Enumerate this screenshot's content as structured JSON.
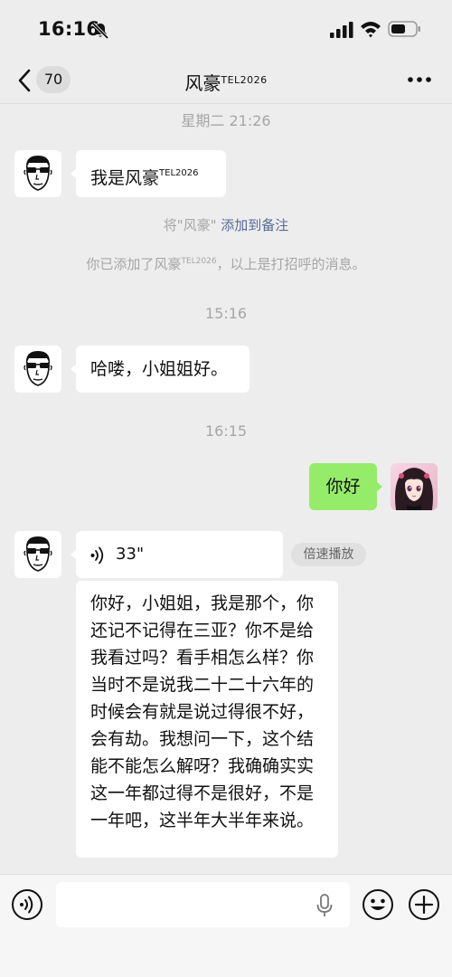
{
  "status_bar": {
    "time": "16:16"
  },
  "nav": {
    "unread_count": "70",
    "title_main": "风豪",
    "title_sup": "TEL2026"
  },
  "messages": {
    "ts1": "星期二 21:26",
    "msg1_main": "我是风豪",
    "msg1_sup": "TEL2026",
    "sys1_prefix": "将\"风豪\"",
    "sys1_link": "添加到备注",
    "sys2_prefix": "你已添加了风豪",
    "sys2_sup": "TEL2026",
    "sys2_suffix": "，以上是打招呼的消息。",
    "ts2": "15:16",
    "msg2": "哈喽，小姐姐好。",
    "ts3": "16:15",
    "msg3_self": "你好",
    "voice_duration": "33\"",
    "speed_label": "倍速播放",
    "transcript": "你好，小姐姐，我是那个，你还记不记得在三亚？你不是给我看过吗？看手相怎么样？你当时不是说我二十二十六年的时候会有就是说过得很不好，会有劫。我想问一下，这个结能不能怎么解呀？我确确实实这一年都过得不是很好，不是一年吧，这半年大半年来说。"
  },
  "colors": {
    "background": "#ededed",
    "self_bubble": "#95ec69",
    "link": "#576b95",
    "timestamp": "#a6a6a6"
  },
  "icons": [
    "bell-slash-icon",
    "signal-icon",
    "wifi-icon",
    "battery-icon",
    "back-chevron-icon",
    "more-dots-icon",
    "voice-wave-icon",
    "voice-mode-icon",
    "microphone-icon",
    "emoji-icon",
    "plus-icon"
  ]
}
